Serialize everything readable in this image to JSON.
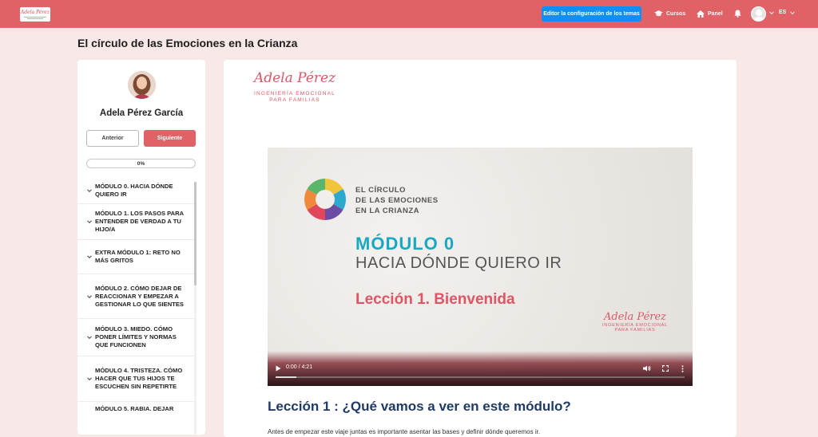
{
  "header": {
    "logo_text": "Adela Pérez",
    "theme_button": "Editor la configuración de los temas",
    "nav_courses": "Cursos",
    "nav_panel": "Panel",
    "language": "ES"
  },
  "page": {
    "title": "El círculo de las Emociones en la Crianza"
  },
  "sidebar": {
    "instructor_name": "Adela Pérez García",
    "prev_label": "Anterior",
    "next_label": "Siguiente",
    "progress_label": "0%",
    "progress_value": 0,
    "modules": [
      {
        "title": "MÓDULO 0. HACIA DÓNDE QUIERO IR"
      },
      {
        "title": "MÓDULO 1. LOS PASOS PARA ENTENDER DE VERDAD A TU HIJO/A"
      },
      {
        "title": "EXTRA MÓDULO 1: RETO NO MÁS GRITOS"
      },
      {
        "title": "MÓDULO 2. CÓMO DEJAR DE REACCIONAR Y EMPEZAR A GESTIONAR LO QUE SIENTES"
      },
      {
        "title": "MÓDULO 3. MIEDO. CÓMO PONER LÍMITES Y NORMAS QUE FUNCIONEN"
      },
      {
        "title": "MÓDULO 4. TRISTEZA. CÓMO HACER QUE TUS HIJOS TE ESCUCHEN SIN REPETIRTE"
      },
      {
        "title": "MÓDULO 5. RABIA. DEJAR"
      }
    ]
  },
  "main": {
    "brand_signature": "Adela Pérez",
    "brand_line1": "INGENIERÍA EMOCIONAL",
    "brand_line2": "PARA FAMILIAS",
    "video": {
      "title_line1": "EL CÍRCULO",
      "title_line2": "DE LAS EMOCIONES",
      "title_line3": "EN LA CRIANZA",
      "module_label": "MÓDULO 0",
      "module_subtitle": "HACIA DÓNDE QUIERO IR",
      "lesson_label": "Lección 1. Bienvenida",
      "brand_signature": "Adela Pérez",
      "brand_line1": "INGENIERÍA EMOCIONAL",
      "brand_line2": "PARA FAMILIAS",
      "time": "0:00 / 4:21",
      "progress_fraction": 0.05
    },
    "lesson_heading": "Lección 1 : ¿Qué vamos a ver en este módulo?",
    "lesson_intro": "Antes de empezar este viaje juntas es importante asentar las bases y definir dónde queremos ir."
  },
  "colors": {
    "topbar": "#e06266",
    "page_bg": "#f8e8e8",
    "accent_blue": "#0d8ff5",
    "heading_navy": "#1f3a66",
    "module_teal": "#19a8c4",
    "lesson_red": "#e05565"
  }
}
